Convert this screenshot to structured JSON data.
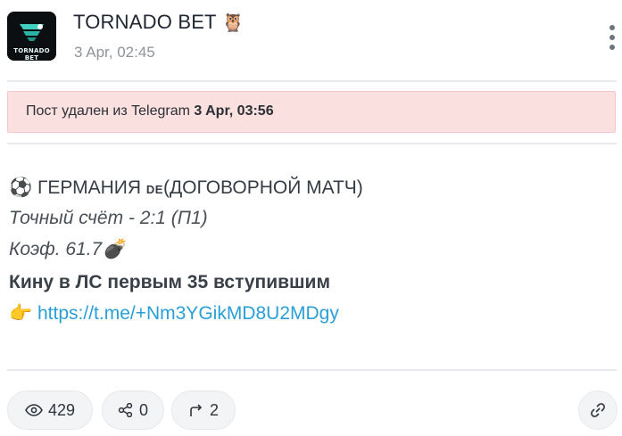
{
  "channel": {
    "name": "TORNADO BET",
    "avatar_text": "TORNADO BET",
    "emoji": "🦉",
    "time": "3 Apr, 02:45"
  },
  "notice": {
    "text": "Пост удален из Telegram ",
    "date": "3 Apr, 03:56"
  },
  "message": {
    "line1_emoji": "⚽",
    "line1_a": " ГЕРМАНИЯ ",
    "line1_flag": "DE",
    "line1_b": "(ДОГОВОРНОЙ МАТЧ)",
    "line2": "Точный счёт - 2:1 (П1)",
    "line3": "Коэф. 61.7",
    "line3_emoji": "💣",
    "line4": "Кину в ЛС первым 35 вступившим",
    "line5_emoji": "👉",
    "link": "https://t.me/+Nm3YGikMD8U2MDgy"
  },
  "stats": {
    "views": "429",
    "reactions": "0",
    "forwards": "2"
  },
  "icons": {
    "views": "eye-icon",
    "reactions": "share-nodes-icon",
    "forwards": "forward-arrow-icon",
    "copy_link": "link-icon",
    "menu": "kebab-menu-icon"
  },
  "colors": {
    "notice_bg": "#fbe0e0",
    "link": "#2a9fd6",
    "muted": "#8d949c"
  }
}
